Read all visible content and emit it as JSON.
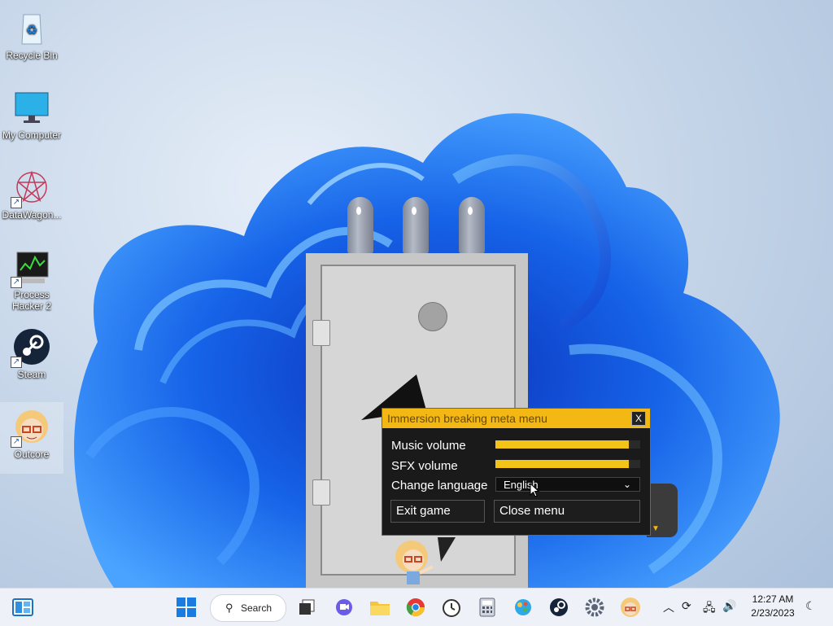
{
  "desktop": {
    "icons": [
      {
        "label": "Recycle Bin",
        "icon": "recycle-bin-icon"
      },
      {
        "label": "My Computer",
        "icon": "monitor-icon"
      },
      {
        "label": "DataWagon...",
        "icon": "datawagon-icon"
      },
      {
        "label": "Process Hacker 2",
        "icon": "process-hacker-icon"
      },
      {
        "label": "Steam",
        "icon": "steam-icon"
      },
      {
        "label": "Outcore",
        "icon": "outcore-icon"
      }
    ]
  },
  "meta_menu": {
    "title": "Immersion breaking meta menu",
    "close_label": "X",
    "music_label": "Music volume",
    "music_level": 0.92,
    "sfx_label": "SFX volume",
    "sfx_level": 0.92,
    "language_label": "Change language",
    "language_value": "English",
    "exit_label": "Exit game",
    "close_menu_label": "Close menu"
  },
  "taskbar": {
    "search_label": "Search",
    "time": "12:27 AM",
    "date": "2/23/2023",
    "apps": [
      "start-icon",
      "task-view-icon",
      "chat-icon",
      "file-explorer-icon",
      "chrome-icon",
      "clock-app-icon",
      "calculator-icon",
      "paint-icon",
      "steam-icon",
      "settings-icon",
      "outcore-icon"
    ]
  },
  "colors": {
    "accent": "#f3b814",
    "menu_bg": "#1a1a1a",
    "taskbar_bg": "#eef2f8"
  }
}
